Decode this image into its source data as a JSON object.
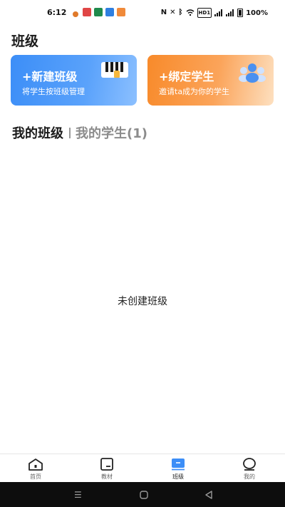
{
  "status_bar": {
    "time": "6:12",
    "battery": "100%",
    "network": "HD1"
  },
  "page": {
    "title": "班级"
  },
  "cards": {
    "new_class": {
      "title": "+新建班级",
      "subtitle": "将学生按班级管理",
      "color": "#3c8ef7"
    },
    "bind_student": {
      "title": "+绑定学生",
      "subtitle": "邀请ta成为你的学生",
      "color": "#f88a2a"
    }
  },
  "tabs": {
    "my_classes": "我的班级",
    "my_students": "我的学生(1)"
  },
  "empty_state": {
    "message": "未创建班级"
  },
  "bottom_nav": {
    "items": [
      {
        "label": "首页",
        "icon": "home-icon"
      },
      {
        "label": "教材",
        "icon": "textbook-icon"
      },
      {
        "label": "班级",
        "icon": "class-icon",
        "active": true
      },
      {
        "label": "我的",
        "icon": "profile-icon"
      }
    ],
    "active_color": "#3c8ef7"
  }
}
